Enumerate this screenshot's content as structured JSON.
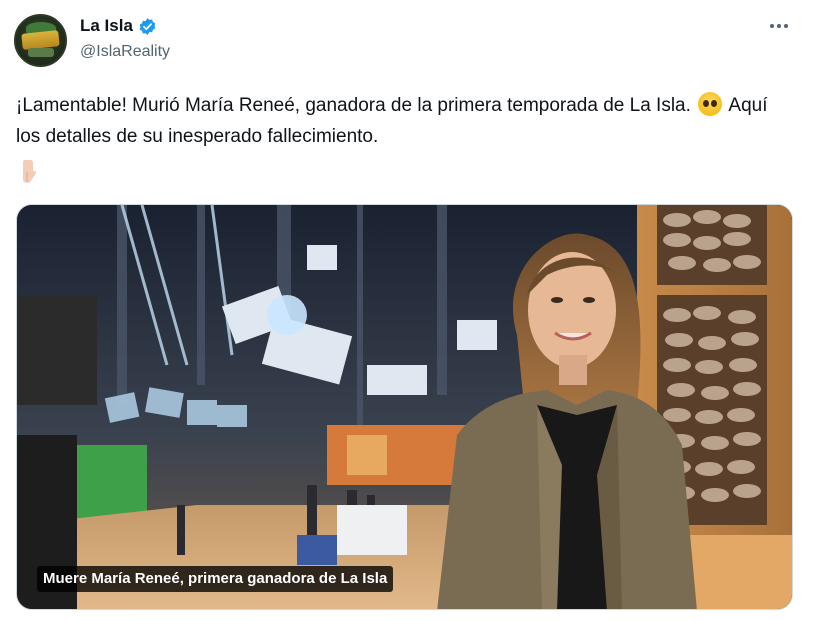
{
  "account": {
    "display_name": "La Isla",
    "handle": "@IslaReality",
    "verified": true,
    "verified_color": "#1d9bf0"
  },
  "tweet": {
    "text_part1": "¡Lamentable! Murió María Reneé, ganadora de la primera temporada de La Isla.",
    "text_part2": "Aquí los detalles de su inesperado fallecimiento.",
    "emoji_1": "pleading-face-emoji",
    "emoji_2": "backhand-index-pointing-down-emoji"
  },
  "media": {
    "caption": "Muere María Reneé, primera ganadora de La Isla"
  },
  "icons": {
    "more": "more-options-icon",
    "verified": "verified-badge-icon"
  }
}
